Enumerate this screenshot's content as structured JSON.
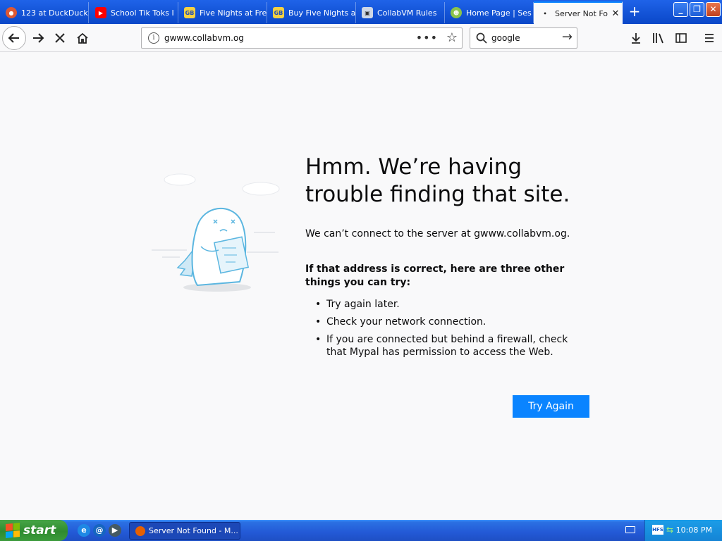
{
  "tabs": [
    {
      "label": "123 at DuckDuckGo",
      "icon": "duckduckgo-icon",
      "active": false
    },
    {
      "label": "School Tik Toks I",
      "icon": "youtube-icon",
      "active": false
    },
    {
      "label": "Five Nights at Fre",
      "icon": "gamebanana-icon",
      "active": false
    },
    {
      "label": "Buy Five Nights a",
      "icon": "gamebanana-icon",
      "active": false
    },
    {
      "label": "CollabVM Rules",
      "icon": "collabvm-icon",
      "active": false
    },
    {
      "label": "Home Page | Ses",
      "icon": "sesame-icon",
      "active": false
    },
    {
      "label": "Server Not Fo",
      "icon": "loading-dot-icon",
      "active": true
    }
  ],
  "window_controls": {
    "minimize": "_",
    "restore": "❐",
    "close": "✕"
  },
  "nav": {
    "url": "gwww.collabvm.og",
    "search_value": "google"
  },
  "error_page": {
    "title": "Hmm. We’re having trouble finding that site.",
    "description": "We can’t connect to the server at gwww.collabvm.og.",
    "tips_heading": "If that address is correct, here are three other things you can try:",
    "tips": [
      "Try again later.",
      "Check your network connection.",
      "If you are connected but behind a firewall, check that Mypal has permission to access the Web."
    ],
    "try_again_label": "Try Again"
  },
  "taskbar": {
    "start_label": "start",
    "task_label": "Server Not Found - M...",
    "clock": "10:08 PM"
  },
  "colors": {
    "accent": "#0a84ff",
    "xp_blue": "#2359d6",
    "start_green": "#2f8b2f"
  }
}
